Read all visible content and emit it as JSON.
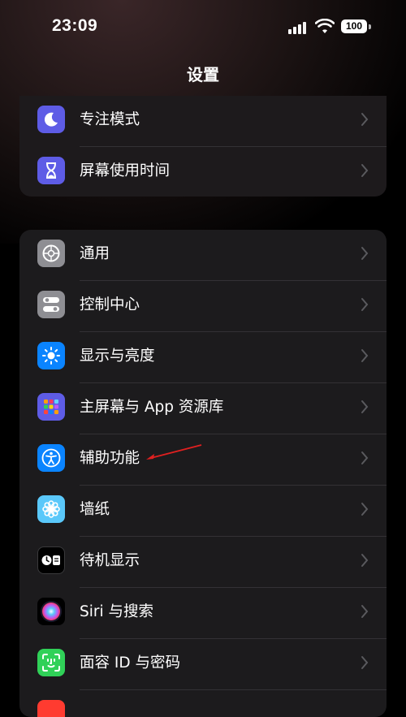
{
  "status": {
    "time": "23:09",
    "battery": "100"
  },
  "nav": {
    "title": "设置"
  },
  "group1": [
    {
      "label": "专注模式",
      "icon": "moon-icon",
      "color": "#5e5ce6"
    },
    {
      "label": "屏幕使用时间",
      "icon": "hourglass-icon",
      "color": "#5e5ce6"
    }
  ],
  "group2": [
    {
      "label": "通用",
      "icon": "gear-icon",
      "color": "#8e8e93"
    },
    {
      "label": "控制中心",
      "icon": "toggles-icon",
      "color": "#8e8e93"
    },
    {
      "label": "显示与亮度",
      "icon": "sun-icon",
      "color": "#0a84ff"
    },
    {
      "label": "主屏幕与 App 资源库",
      "icon": "app-grid-icon",
      "color": "#5e5ce6"
    },
    {
      "label": "辅助功能",
      "icon": "accessibility-icon",
      "color": "#0a84ff"
    },
    {
      "label": "墙纸",
      "icon": "flower-icon",
      "color": "#5ac8fa"
    },
    {
      "label": "待机显示",
      "icon": "standby-icon",
      "color": "#000000"
    },
    {
      "label": "Siri 与搜索",
      "icon": "siri-icon",
      "color": "#000000"
    },
    {
      "label": "面容 ID 与密码",
      "icon": "face-id-icon",
      "color": "#30d158"
    }
  ]
}
